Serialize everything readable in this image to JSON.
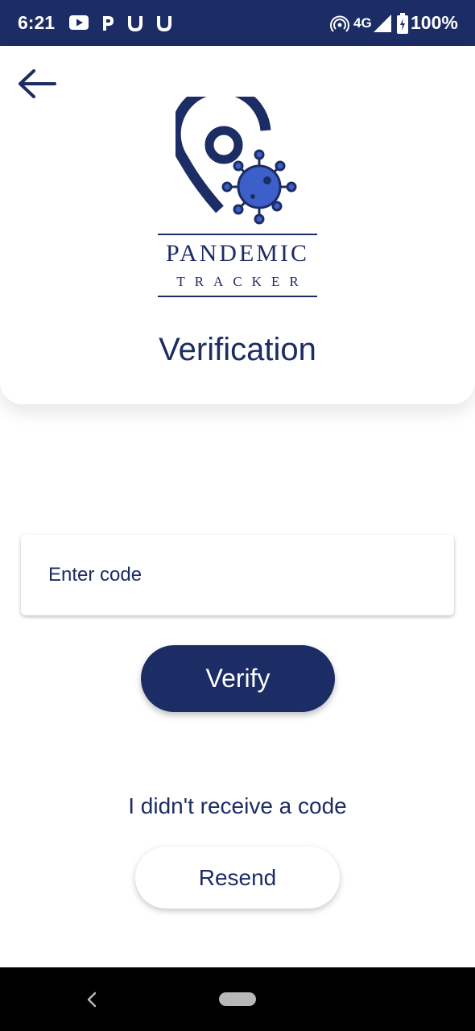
{
  "status_bar": {
    "time": "6:21",
    "notification_icons": [
      "youtube-icon",
      "p-app-icon",
      "u-app-icon",
      "u-app-icon"
    ],
    "network": "4G",
    "battery": "100%"
  },
  "header": {
    "back_icon": "arrow-left-icon",
    "brand_name": "PANDEMIC",
    "brand_sub": "TRACKER",
    "title": "Verification"
  },
  "form": {
    "code_placeholder": "Enter code",
    "code_value": "",
    "verify_label": "Verify",
    "no_code_text": "I didn't receive a code",
    "resend_label": "Resend"
  },
  "colors": {
    "primary": "#1c2c64",
    "virus": "#3d5fc9",
    "background": "#ffffff"
  }
}
